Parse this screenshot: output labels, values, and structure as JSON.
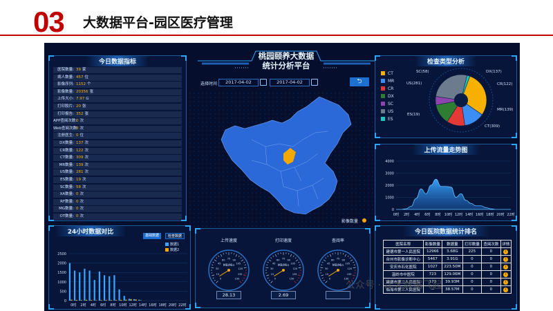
{
  "header": {
    "number": "03",
    "title": "大数据平台-园区医疗管理"
  },
  "watermark": "公众号 · 江大数据飞起",
  "left_panel": {
    "title": "今日数据指标",
    "stats": [
      {
        "label": "医院数量:",
        "value": "39",
        "unit": "家"
      },
      {
        "label": "病人数量:",
        "value": "457",
        "unit": "位"
      },
      {
        "label": "影像序列:",
        "value": "1152",
        "unit": "个"
      },
      {
        "label": "影像数量:",
        "value": "20356",
        "unit": "张"
      },
      {
        "label": "上传大小:",
        "value": "7.97",
        "unit": "G"
      },
      {
        "label": "打印胶片:",
        "value": "20",
        "unit": "张"
      },
      {
        "label": "打印报告:",
        "value": "352",
        "unit": "张"
      },
      {
        "label": "APP查阅次数:",
        "value": "0",
        "unit": "次"
      },
      {
        "label": "Web查阅次数:",
        "value": "0",
        "unit": "次"
      },
      {
        "label": "注册医生:",
        "value": "0",
        "unit": "位"
      },
      {
        "label": "DX数量:",
        "value": "137",
        "unit": "次"
      },
      {
        "label": "CR数量:",
        "value": "122",
        "unit": "次"
      },
      {
        "label": "CT数量:",
        "value": "309",
        "unit": "次"
      },
      {
        "label": "MR数量:",
        "value": "139",
        "unit": "次"
      },
      {
        "label": "US数量:",
        "value": "281",
        "unit": "次"
      },
      {
        "label": "ES数量:",
        "value": "19",
        "unit": "次"
      },
      {
        "label": "SC数量:",
        "value": "58",
        "unit": "次"
      },
      {
        "label": "XA数量:",
        "value": "0",
        "unit": "次"
      },
      {
        "label": "RF数量:",
        "value": "0",
        "unit": "次"
      },
      {
        "label": "MG数量:",
        "value": "0",
        "unit": "次"
      },
      {
        "label": "OT数量:",
        "value": "0",
        "unit": "次"
      }
    ]
  },
  "center": {
    "title_line1": "桃园颐养大数据",
    "title_line2": "统计分析平台",
    "time_label": "选择时间",
    "date_start": "2017-04-02",
    "date_end": "2017-04-02",
    "back_symbol": "⮌",
    "map_legend": "影像数量"
  },
  "pie_panel": {
    "title": "检查类型分析",
    "legend": [
      {
        "name": "CT",
        "color": "#f5b000"
      },
      {
        "name": "MR",
        "color": "#3a8ef6"
      },
      {
        "name": "CR",
        "color": "#e53935"
      },
      {
        "name": "DX",
        "color": "#2e7d32"
      },
      {
        "name": "SC",
        "color": "#8e44ad"
      },
      {
        "name": "US",
        "color": "#6d7b8f"
      },
      {
        "name": "ES",
        "color": "#18c9c0"
      }
    ],
    "labels": {
      "sc": "SC(58)",
      "dx": "DX(137)",
      "us": "US(281)",
      "cr": "CR(122)",
      "es": "ES(19)",
      "mr": "MR(139)",
      "ct": "CT(309)"
    }
  },
  "upload_panel": {
    "title": "上传流量走势图",
    "y_ticks": [
      "4000",
      "3000",
      "2000",
      "1000",
      "0"
    ],
    "x_ticks": [
      "0时",
      "2时",
      "4时",
      "6时",
      "8时",
      "10时",
      "12时",
      "14时",
      "16时",
      "18时",
      "20时",
      "22时"
    ]
  },
  "hourly_panel": {
    "title": "24小时数据对比",
    "toggle_a": "基础数据",
    "toggle_b": "检查数据",
    "series_a": "数据1",
    "series_b": "数据2",
    "y_ticks": [
      "2500",
      "2000",
      "1500",
      "1000",
      "500",
      "0"
    ],
    "x_ticks": [
      "0时",
      "2时",
      "4时",
      "6时",
      "8时",
      "10时",
      "12时",
      "14时",
      "16时",
      "18时",
      "20时",
      "22时"
    ]
  },
  "gauge_panel": {
    "gauges": [
      {
        "label": "上传速度",
        "unit": "MB/Min",
        "value": "28.13"
      },
      {
        "label": "打印速度",
        "unit": "MB/Min",
        "value": "2.69"
      },
      {
        "label": "查阅率",
        "unit": "MB/Min",
        "value": ""
      }
    ],
    "ticks": [
      "0",
      "15",
      "30",
      "45",
      "60",
      "75",
      "90",
      "105",
      "120",
      "135",
      "150"
    ]
  },
  "ranking_panel": {
    "title": "今日医院数据统计排名",
    "headers": [
      "医院名称",
      "影像数量",
      "数据量",
      "打印数量",
      "查阅次数",
      "详情"
    ],
    "rows": [
      [
        "建德市第一人民医院",
        "12966",
        "3.68G",
        "225",
        "0"
      ],
      [
        "台州市影像诊断中心",
        "5467",
        "3.91G",
        "0",
        "0"
      ],
      [
        "安庆市石化医院",
        "1027",
        "223.50M",
        "0",
        "0"
      ],
      [
        "温岭市中医院",
        "723",
        "129.06M",
        "0",
        "0"
      ],
      [
        "建德市第二人民医院",
        "173",
        "39.93M",
        "0",
        "0"
      ],
      [
        "临海市第三人民医院",
        "—",
        "38.57M",
        "0",
        "0"
      ]
    ],
    "detail_symbol": "i"
  },
  "chart_data": [
    {
      "type": "pie",
      "title": "检查类型分析",
      "categories": [
        "CT",
        "MR",
        "CR",
        "DX",
        "SC",
        "US",
        "ES"
      ],
      "values": [
        309,
        139,
        122,
        137,
        58,
        281,
        19
      ]
    },
    {
      "type": "area",
      "title": "上传流量走势图",
      "x": [
        "0时",
        "1时",
        "2时",
        "3时",
        "4时",
        "5时",
        "6时",
        "7时",
        "8时",
        "9时",
        "10时",
        "11时",
        "12时",
        "13时",
        "14时",
        "15时",
        "16时",
        "17时",
        "18时",
        "19时",
        "20时",
        "21时",
        "22时",
        "23时"
      ],
      "values": [
        0,
        0,
        50,
        250,
        900,
        1700,
        1300,
        2000,
        2500,
        1900,
        1900,
        1850,
        1000,
        1300,
        750,
        500,
        300,
        300,
        150,
        50,
        0,
        0,
        0,
        0
      ],
      "ylim": [
        0,
        4000
      ]
    },
    {
      "type": "bar",
      "title": "24小时数据对比",
      "categories": [
        "0时",
        "1时",
        "2时",
        "3时",
        "4时",
        "5时",
        "6时",
        "7时",
        "8时",
        "9时",
        "10时",
        "11时",
        "12时",
        "13时",
        "14时",
        "15时",
        "16时",
        "17时",
        "18时",
        "19时",
        "20时",
        "21时",
        "22时",
        "23时"
      ],
      "series": [
        {
          "name": "数据1",
          "values": [
            2000,
            1600,
            1500,
            1700,
            1600,
            1100,
            1550,
            1350,
            1300,
            1350,
            600,
            250,
            100,
            80,
            50,
            0,
            0,
            0,
            0,
            0,
            0,
            0,
            0,
            0
          ]
        },
        {
          "name": "数据2",
          "values": [
            50,
            40,
            30,
            40,
            30,
            20,
            30,
            30,
            30,
            30,
            40,
            50,
            80,
            60,
            20,
            0,
            0,
            0,
            0,
            0,
            0,
            0,
            0,
            0
          ]
        }
      ],
      "ylim": [
        0,
        2500
      ]
    }
  ]
}
